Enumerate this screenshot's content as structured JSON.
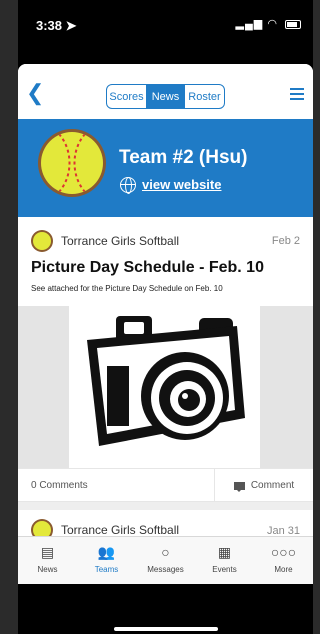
{
  "status_bar": {
    "time": "3:38",
    "location_icon": "location-arrow-icon",
    "signal": "signal-icon",
    "wifi": "wifi-icon",
    "battery": "battery-icon"
  },
  "header": {
    "back_icon": "chevron-left-icon",
    "tabs": [
      {
        "label": "Scores",
        "active": false
      },
      {
        "label": "News",
        "active": true
      },
      {
        "label": "Roster",
        "active": false
      }
    ],
    "menu_icon": "hamburger-menu-icon"
  },
  "team_banner": {
    "name": "Team #2 (Hsu)",
    "website_label": "view website",
    "globe_icon": "globe-icon",
    "accent_color": "#1f7bc6"
  },
  "posts": [
    {
      "author": "Torrance Girls Softball",
      "date": "Feb 2",
      "title": "Picture Day Schedule - Feb. 10",
      "description": "See attached for the Picture Day Schedule on Feb. 10",
      "image": "camera-illustration",
      "comments_count": "0 Comments",
      "comment_button": "Comment"
    },
    {
      "author": "Torrance Girls Softball",
      "date": "Jan 31"
    }
  ],
  "tab_bar": [
    {
      "label": "News",
      "icon": "news-icon",
      "active": false
    },
    {
      "label": "Teams",
      "icon": "teams-icon",
      "active": true
    },
    {
      "label": "Messages",
      "icon": "messages-icon",
      "active": false
    },
    {
      "label": "Events",
      "icon": "calendar-icon",
      "active": false
    },
    {
      "label": "More",
      "icon": "more-dots-icon",
      "active": false
    }
  ]
}
